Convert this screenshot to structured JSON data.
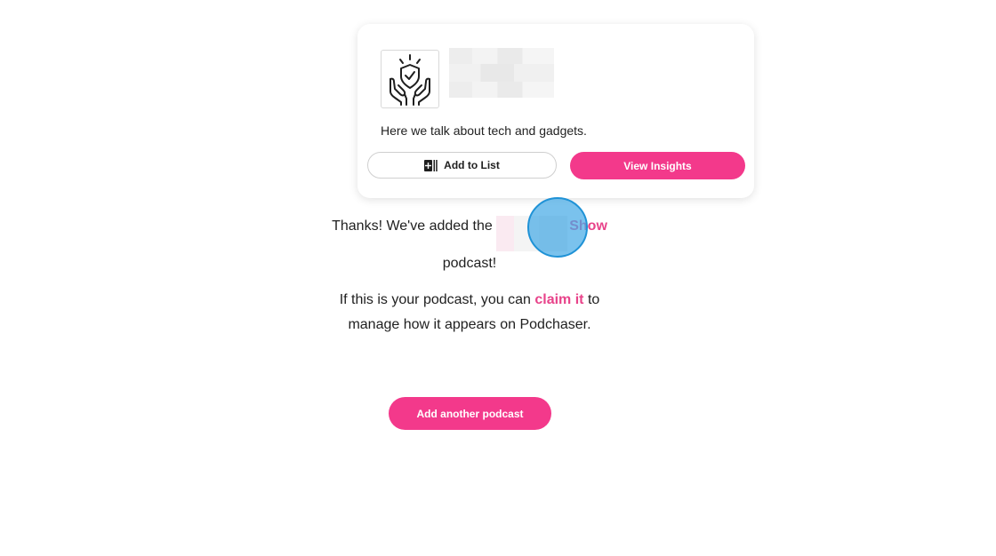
{
  "card": {
    "cover_icon": "hands-shield-check-icon",
    "description": "Here we talk about tech and gadgets.",
    "add_to_list_label": "Add to List",
    "add_to_list_icon": "playlist-add-icon",
    "view_insights_label": "View Insights"
  },
  "message": {
    "thanks_prefix": "Thanks! We've added the",
    "podcast_name_suffix": "Show",
    "thanks_suffix": "podcast!",
    "claim_prefix": "If this is your podcast, you can",
    "claim_link": "claim it",
    "claim_suffix_line1": "to",
    "claim_line2": "manage how it appears on Podchaser."
  },
  "actions": {
    "add_another_label": "Add another podcast"
  },
  "colors": {
    "accent": "#f3398b",
    "link": "#e8438a",
    "click_marker": "#46aae6"
  }
}
